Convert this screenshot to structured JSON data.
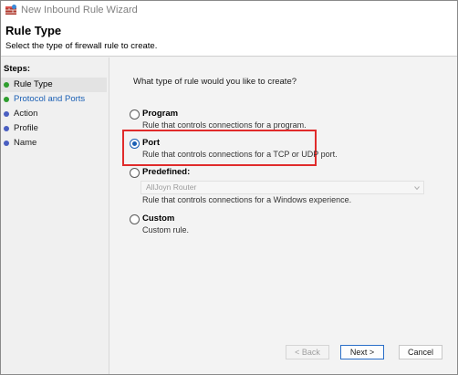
{
  "window": {
    "title": "New Inbound Rule Wizard"
  },
  "header": {
    "title": "Rule Type",
    "subtitle": "Select the type of firewall rule to create."
  },
  "sidebar": {
    "title": "Steps:",
    "items": [
      {
        "label": "Rule Type",
        "color": "#2e9e2e"
      },
      {
        "label": "Protocol and Ports",
        "color": "#2e9e2e"
      },
      {
        "label": "Action",
        "color": "#4a5fc1"
      },
      {
        "label": "Profile",
        "color": "#4a5fc1"
      },
      {
        "label": "Name",
        "color": "#4a5fc1"
      }
    ]
  },
  "main": {
    "question": "What type of rule would you like to create?",
    "options": [
      {
        "label": "Program",
        "description": "Rule that controls connections for a program.",
        "selected": false
      },
      {
        "label": "Port",
        "description": "Rule that controls connections for a TCP or UDP port.",
        "selected": true
      },
      {
        "label": "Predefined:",
        "description": "Rule that controls connections for a Windows experience.",
        "selected": false
      },
      {
        "label": "Custom",
        "description": "Custom rule.",
        "selected": false
      }
    ],
    "predefined_dropdown": {
      "value": "AllJoyn Router"
    }
  },
  "buttons": {
    "back": "< Back",
    "next": "Next >",
    "cancel": "Cancel"
  },
  "colors": {
    "accent": "#1a5fb4",
    "highlight": "#e02b2b",
    "active_link": "#1a5fb4"
  }
}
